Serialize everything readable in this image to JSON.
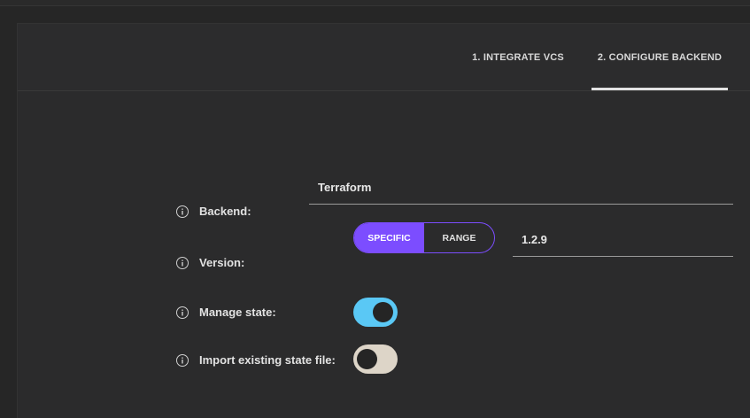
{
  "tabs": [
    {
      "label": "1. INTEGRATE VCS",
      "active": false
    },
    {
      "label": "2. CONFIGURE BACKEND",
      "active": true
    }
  ],
  "form": {
    "backend": {
      "label": "Backend:",
      "value": "Terraform"
    },
    "version": {
      "label": "Version:",
      "mode_options": [
        "SPECIFIC",
        "RANGE"
      ],
      "selected_mode": "SPECIFIC",
      "value": "1.2.9"
    },
    "manage_state": {
      "label": "Manage state:",
      "enabled": true
    },
    "import_state": {
      "label": "Import existing state file:",
      "enabled": false
    }
  },
  "colors": {
    "accent": "#7c4dff",
    "toggle_on": "#5ac8f5",
    "toggle_off": "#ddd5c8"
  },
  "icons": {
    "info": "info-circle-icon"
  }
}
